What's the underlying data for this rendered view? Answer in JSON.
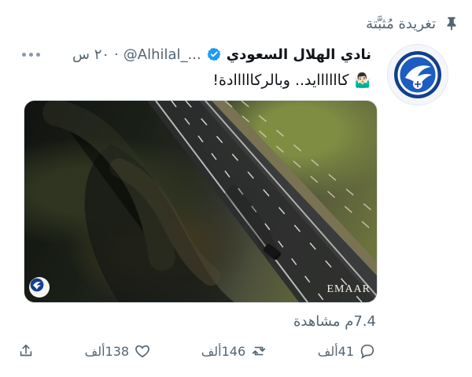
{
  "pinned_label": "تغريدة مُثبَّتة",
  "account": {
    "name": "نادي الهلال السعودي",
    "handle": "@Alhilal_...",
    "time": "٢٠ س",
    "dot": "·"
  },
  "tweet": {
    "text": "كاااااايد.. وبالركااااادة!",
    "emoji": "🤷🏻‍♂️"
  },
  "media": {
    "brand": "EMAAR"
  },
  "views": "7.4م مشاهدة",
  "actions": {
    "reply": "41ألف",
    "retweet": "146ألف",
    "like": "138ألف"
  },
  "colors": {
    "accent": "#1d9bf0",
    "muted": "#536471",
    "club_blue": "#123f8d"
  },
  "icons": [
    "pin-icon",
    "verified-icon",
    "more-icon",
    "reply-icon",
    "retweet-icon",
    "like-icon",
    "share-icon"
  ]
}
